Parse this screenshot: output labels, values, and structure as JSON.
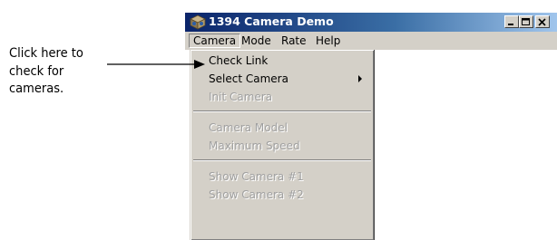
{
  "annotation": {
    "lines": [
      "Click here to",
      "check for",
      "cameras."
    ]
  },
  "window": {
    "title": "1394 Camera Demo",
    "title_icon": "camera-cube-icon",
    "controls": [
      "minimize-icon",
      "maximize-icon",
      "close-icon"
    ]
  },
  "menubar": {
    "items": [
      "Camera",
      "Mode",
      "Rate",
      "Help"
    ],
    "active": "Camera"
  },
  "camera_menu": {
    "items": [
      {
        "label": "Check Link",
        "enabled": true
      },
      {
        "label": "Select Camera",
        "enabled": true,
        "submenu": true
      },
      {
        "label": "Init Camera",
        "enabled": false
      },
      {
        "label": "Camera Model",
        "enabled": false
      },
      {
        "label": "Maximum Speed",
        "enabled": false
      },
      {
        "label": "Show Camera #1",
        "enabled": false
      },
      {
        "label": "Show Camera #2",
        "enabled": false
      }
    ]
  },
  "colors": {
    "titlebar_start": "#0a246a",
    "titlebar_end": "#a6caf0",
    "face": "#d4d0c8",
    "disabled_text": "#a0a0a0"
  }
}
